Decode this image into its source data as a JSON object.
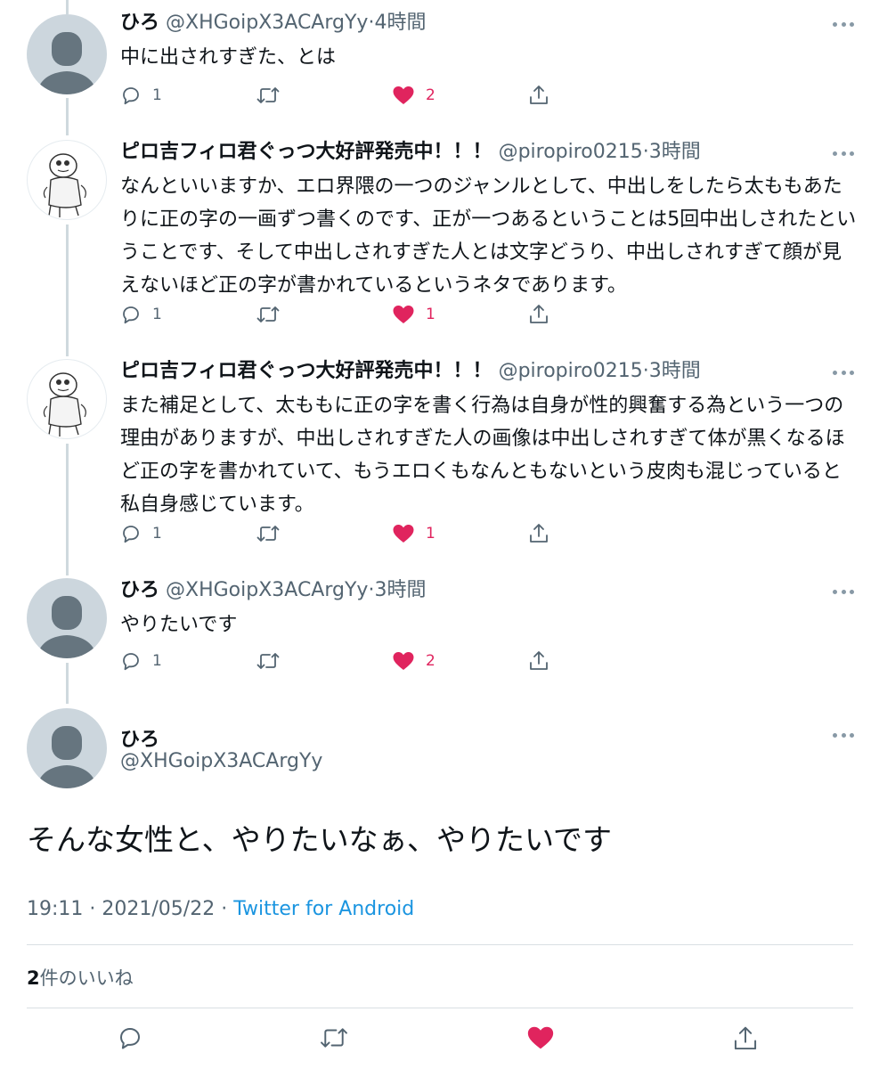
{
  "tweets": [
    {
      "name": "ひろ",
      "handle": "@XHGoipX3ACArgYy",
      "sep": "·",
      "time": "4時間",
      "text": "中に出されすぎた、とは",
      "replies": "1",
      "retweets": "",
      "likes": "2",
      "liked": true,
      "avatar": "default-avatar"
    },
    {
      "name": "ピロ吉フィロ君ぐっつ大好評発売中！！！",
      "handle": "@piropiro0215",
      "sep": "·",
      "time": "3時間",
      "text": "なんといいますか、エロ界隈の一つのジャンルとして、中出しをしたら太ももあたりに正の字の一画ずつ書くのです、正が一つあるということは5回中出しされたということです、そして中出しされすぎた人とは文字どうり、中出しされすぎて顔が見えないほど正の字が書かれているというネタであります。",
      "replies": "1",
      "retweets": "",
      "likes": "1",
      "liked": true,
      "avatar": "illustrated-character"
    },
    {
      "name": "ピロ吉フィロ君ぐっつ大好評発売中！！！",
      "handle": "@piropiro0215",
      "sep": "·",
      "time": "3時間",
      "text": "また補足として、太ももに正の字を書く行為は自身が性的興奮する為という一つの理由がありますが、中出しされすぎた人の画像は中出しされすぎて体が黒くなるほど正の字を書かれていて、もうエロくもなんともないという皮肉も混じっていると私自身感じています。",
      "replies": "1",
      "retweets": "",
      "likes": "1",
      "liked": true,
      "avatar": "illustrated-character"
    },
    {
      "name": "ひろ",
      "handle": "@XHGoipX3ACArgYy",
      "sep": "·",
      "time": "3時間",
      "text": "やりたいです",
      "replies": "1",
      "retweets": "",
      "likes": "2",
      "liked": true,
      "avatar": "default-avatar"
    }
  ],
  "main_tweet": {
    "name": "ひろ",
    "handle": "@XHGoipX3ACArgYy",
    "text": "そんな女性と、やりたいなぁ、やりたいです",
    "time": "19:11",
    "date": "2021/05/22",
    "sep1": "·",
    "sep2": "·",
    "source": "Twitter for Android",
    "likes_count": "2",
    "likes_label": "件のいいね",
    "liked": true
  },
  "icons": {
    "reply": "reply-icon",
    "retweet": "retweet-icon",
    "like": "heart-icon",
    "share": "share-icon",
    "more": "more-icon"
  },
  "colors": {
    "like": "#e0245e",
    "link": "#1b95e0",
    "muted": "#536471",
    "avatar_bg": "#ccd6dd",
    "avatar_fg": "#66757f"
  }
}
